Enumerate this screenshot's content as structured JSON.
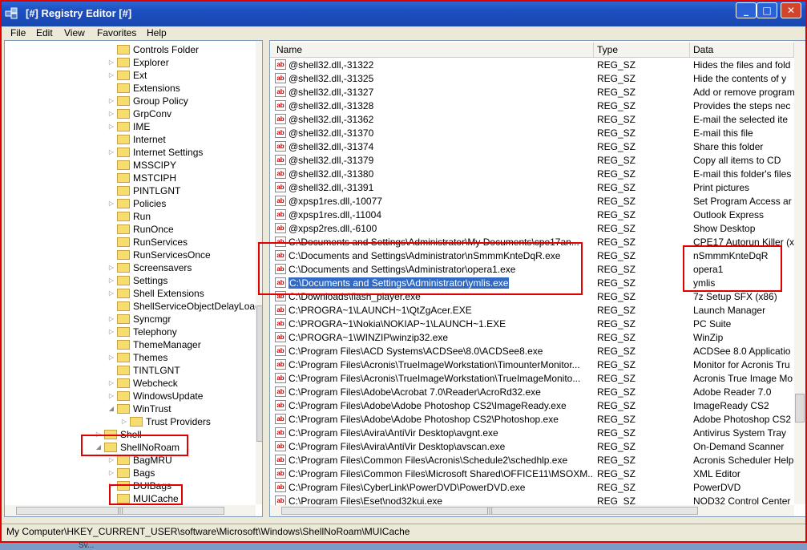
{
  "window": {
    "title": "[#] Registry Editor [#]",
    "min_label": "_",
    "max_label": "□",
    "close_label": "✕"
  },
  "menu": [
    "File",
    "Edit",
    "View",
    "Favorites",
    "Help"
  ],
  "tree": {
    "items": [
      {
        "label": "Controls Folder",
        "expander": ""
      },
      {
        "label": "Explorer",
        "expander": "▷"
      },
      {
        "label": "Ext",
        "expander": "▷"
      },
      {
        "label": "Extensions",
        "expander": ""
      },
      {
        "label": "Group Policy",
        "expander": "▷"
      },
      {
        "label": "GrpConv",
        "expander": "▷"
      },
      {
        "label": "IME",
        "expander": "▷"
      },
      {
        "label": "Internet",
        "expander": ""
      },
      {
        "label": "Internet Settings",
        "expander": "▷"
      },
      {
        "label": "MSSCIPY",
        "expander": ""
      },
      {
        "label": "MSTCIPH",
        "expander": ""
      },
      {
        "label": "PINTLGNT",
        "expander": ""
      },
      {
        "label": "Policies",
        "expander": "▷"
      },
      {
        "label": "Run",
        "expander": ""
      },
      {
        "label": "RunOnce",
        "expander": ""
      },
      {
        "label": "RunServices",
        "expander": ""
      },
      {
        "label": "RunServicesOnce",
        "expander": ""
      },
      {
        "label": "Screensavers",
        "expander": "▷"
      },
      {
        "label": "Settings",
        "expander": "▷"
      },
      {
        "label": "Shell Extensions",
        "expander": "▷"
      },
      {
        "label": "ShellServiceObjectDelayLoad",
        "expander": ""
      },
      {
        "label": "Syncmgr",
        "expander": "▷"
      },
      {
        "label": "Telephony",
        "expander": "▷"
      },
      {
        "label": "ThemeManager",
        "expander": ""
      },
      {
        "label": "Themes",
        "expander": "▷"
      },
      {
        "label": "TINTLGNT",
        "expander": ""
      },
      {
        "label": "Webcheck",
        "expander": "▷"
      },
      {
        "label": "WindowsUpdate",
        "expander": "▷"
      },
      {
        "label": "WinTrust",
        "expander": "◢"
      },
      {
        "label": "Trust Providers",
        "expander": "▷"
      },
      {
        "label": "Shell",
        "expander": "▷"
      },
      {
        "label": "ShellNoRoam",
        "expander": "◢"
      },
      {
        "label": "BagMRU",
        "expander": "▷"
      },
      {
        "label": "Bags",
        "expander": "▷"
      },
      {
        "label": "DUIBags",
        "expander": "▷"
      },
      {
        "label": "MUICache",
        "expander": ""
      }
    ],
    "hscroll_grip": "|||"
  },
  "list": {
    "columns": {
      "name": "Name",
      "type": "Type",
      "data": "Data"
    },
    "icon_text": "ab",
    "rows": [
      {
        "name": "@shell32.dll,-31322",
        "type": "REG_SZ",
        "data": "Hides the files and fold"
      },
      {
        "name": "@shell32.dll,-31325",
        "type": "REG_SZ",
        "data": "Hide the contents of y"
      },
      {
        "name": "@shell32.dll,-31327",
        "type": "REG_SZ",
        "data": "Add or remove program"
      },
      {
        "name": "@shell32.dll,-31328",
        "type": "REG_SZ",
        "data": "Provides the steps nec"
      },
      {
        "name": "@shell32.dll,-31362",
        "type": "REG_SZ",
        "data": "E-mail the selected ite"
      },
      {
        "name": "@shell32.dll,-31370",
        "type": "REG_SZ",
        "data": "E-mail this file"
      },
      {
        "name": "@shell32.dll,-31374",
        "type": "REG_SZ",
        "data": "Share this folder"
      },
      {
        "name": "@shell32.dll,-31379",
        "type": "REG_SZ",
        "data": "Copy all items to CD"
      },
      {
        "name": "@shell32.dll,-31380",
        "type": "REG_SZ",
        "data": "E-mail this folder's files"
      },
      {
        "name": "@shell32.dll,-31391",
        "type": "REG_SZ",
        "data": "Print pictures"
      },
      {
        "name": "@xpsp1res.dll,-10077",
        "type": "REG_SZ",
        "data": "Set Program Access ar"
      },
      {
        "name": "@xpsp1res.dll,-11004",
        "type": "REG_SZ",
        "data": "Outlook Express"
      },
      {
        "name": "@xpsp2res.dll,-6100",
        "type": "REG_SZ",
        "data": "Show Desktop"
      },
      {
        "name": "C:\\Documents and Settings\\Administrator\\My Documents\\cpe17an...",
        "type": "REG_SZ",
        "data": "CPE17 Autorun Killer (x"
      },
      {
        "name": "C:\\Documents and Settings\\Administrator\\nSmmmKnteDqR.exe",
        "type": "REG_SZ",
        "data": "nSmmmKnteDqR"
      },
      {
        "name": "C:\\Documents and Settings\\Administrator\\opera1.exe",
        "type": "REG_SZ",
        "data": "opera1"
      },
      {
        "name": "C:\\Documents and Settings\\Administrator\\ymlis.exe",
        "type": "REG_SZ",
        "data": "ymlis",
        "selected": true
      },
      {
        "name": "C:\\Downloads\\flash_player.exe",
        "type": "REG_SZ",
        "data": "7z Setup SFX (x86)"
      },
      {
        "name": "C:\\PROGRA~1\\LAUNCH~1\\QtZgAcer.EXE",
        "type": "REG_SZ",
        "data": "Launch Manager"
      },
      {
        "name": "C:\\PROGRA~1\\Nokia\\NOKIAP~1\\LAUNCH~1.EXE",
        "type": "REG_SZ",
        "data": "PC Suite"
      },
      {
        "name": "C:\\PROGRA~1\\WINZIP\\winzip32.exe",
        "type": "REG_SZ",
        "data": "WinZip"
      },
      {
        "name": "C:\\Program Files\\ACD Systems\\ACDSee\\8.0\\ACDSee8.exe",
        "type": "REG_SZ",
        "data": "ACDSee 8.0 Applicatio"
      },
      {
        "name": "C:\\Program Files\\Acronis\\TrueImageWorkstation\\TimounterMonitor...",
        "type": "REG_SZ",
        "data": "Monitor for Acronis Tru"
      },
      {
        "name": "C:\\Program Files\\Acronis\\TrueImageWorkstation\\TrueImageMonito...",
        "type": "REG_SZ",
        "data": "Acronis True Image Mo"
      },
      {
        "name": "C:\\Program Files\\Adobe\\Acrobat 7.0\\Reader\\AcroRd32.exe",
        "type": "REG_SZ",
        "data": "Adobe Reader 7.0"
      },
      {
        "name": "C:\\Program Files\\Adobe\\Adobe Photoshop CS2\\ImageReady.exe",
        "type": "REG_SZ",
        "data": "ImageReady CS2"
      },
      {
        "name": "C:\\Program Files\\Adobe\\Adobe Photoshop CS2\\Photoshop.exe",
        "type": "REG_SZ",
        "data": "Adobe Photoshop CS2"
      },
      {
        "name": "C:\\Program Files\\Avira\\AntiVir Desktop\\avgnt.exe",
        "type": "REG_SZ",
        "data": "Antivirus System Tray"
      },
      {
        "name": "C:\\Program Files\\Avira\\AntiVir Desktop\\avscan.exe",
        "type": "REG_SZ",
        "data": "On-Demand Scanner"
      },
      {
        "name": "C:\\Program Files\\Common Files\\Acronis\\Schedule2\\schedhlp.exe",
        "type": "REG_SZ",
        "data": "Acronis Scheduler Help"
      },
      {
        "name": "C:\\Program Files\\Common Files\\Microsoft Shared\\OFFICE11\\MSOXM...",
        "type": "REG_SZ",
        "data": "XML Editor"
      },
      {
        "name": "C:\\Program Files\\CyberLink\\PowerDVD\\PowerDVD.exe",
        "type": "REG_SZ",
        "data": "PowerDVD"
      },
      {
        "name": "C:\\Program Files\\Eset\\nod32kui.exe",
        "type": "REG_SZ",
        "data": "NOD32 Control Center"
      }
    ],
    "hscroll_grip": "|||"
  },
  "status": {
    "path": "My Computer\\HKEY_CURRENT_USER\\software\\Microsoft\\Windows\\ShellNoRoam\\MUICache"
  },
  "taskbar": {
    "text": "Sv..."
  },
  "colors": {
    "annotation": "#e00000",
    "selection": "#316ac5"
  }
}
